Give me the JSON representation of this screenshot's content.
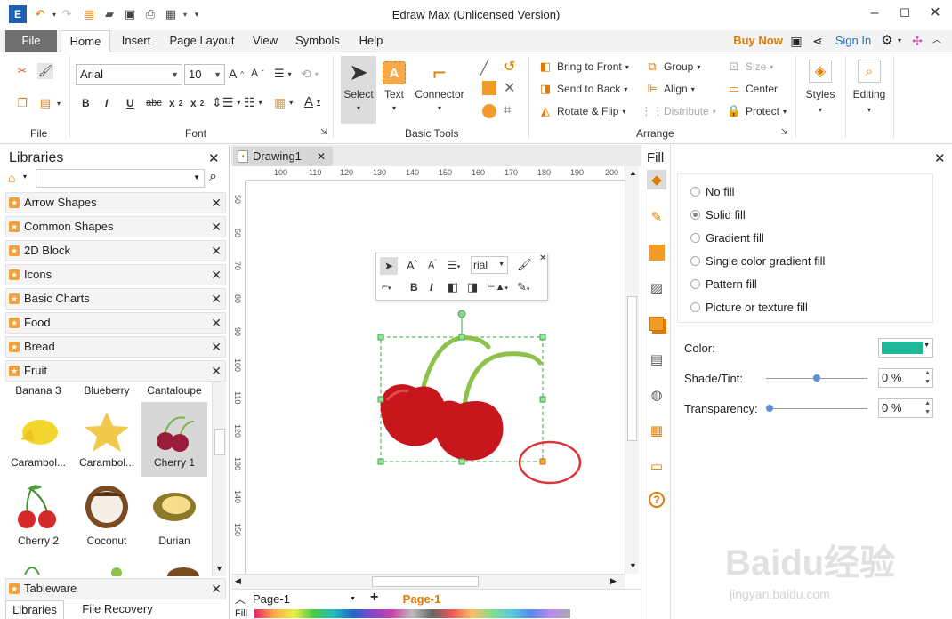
{
  "app": {
    "title": "Edraw Max (Unlicensed Version)"
  },
  "tabs": {
    "file": "File",
    "items": [
      "Home",
      "Insert",
      "Page Layout",
      "View",
      "Symbols",
      "Help"
    ],
    "buy_now": "Buy Now",
    "sign_in": "Sign In"
  },
  "ribbon": {
    "file_group": "File",
    "font_group": "Font",
    "font_name": "Arial",
    "font_size": "10",
    "basic_tools_group": "Basic Tools",
    "select": "Select",
    "text": "Text",
    "connector": "Connector",
    "arrange_group": "Arrange",
    "bring_to_front": "Bring to Front",
    "send_to_back": "Send to Back",
    "rotate_flip": "Rotate & Flip",
    "group": "Group",
    "align": "Align",
    "distribute": "Distribute",
    "size": "Size",
    "center": "Center",
    "protect": "Protect",
    "styles": "Styles",
    "editing": "Editing"
  },
  "libraries": {
    "title": "Libraries",
    "items": [
      "Arrow Shapes",
      "Common Shapes",
      "2D Block",
      "Icons",
      "Basic Charts",
      "Food",
      "Bread",
      "Fruit"
    ],
    "shape_row_top": [
      "Banana 3",
      "Blueberry",
      "Cantaloupe"
    ],
    "shape_row_1": [
      "Carambol...",
      "Carambol...",
      "Cherry 1"
    ],
    "shape_row_2": [
      "Cherry 2",
      "Coconut",
      "Durian"
    ],
    "tableware": "Tableware",
    "bottom_tab_libraries": "Libraries",
    "bottom_tab_recovery": "File Recovery"
  },
  "document": {
    "tab": "Drawing1",
    "ruler_top": [
      "100",
      "110",
      "120",
      "130",
      "140",
      "150",
      "160",
      "170",
      "180",
      "190",
      "200"
    ],
    "ruler_left": [
      "50",
      "60",
      "70",
      "80",
      "90",
      "100",
      "110",
      "120",
      "130",
      "140",
      "150"
    ],
    "page_select": "Page-1",
    "page_tab": "Page-1",
    "fill_label": "Fill"
  },
  "floating_toolbar": {
    "font": "rial"
  },
  "fill_panel": {
    "title": "Fill",
    "options": [
      "No fill",
      "Solid fill",
      "Gradient fill",
      "Single color gradient fill",
      "Pattern fill",
      "Picture or texture fill"
    ],
    "selected_index": 1,
    "color_label": "Color:",
    "color_value": "#1fb99a",
    "shade_label": "Shade/Tint:",
    "shade_value": "0 %",
    "transparency_label": "Transparency:",
    "transparency_value": "0 %"
  },
  "watermark": {
    "brand": "Baidu经验",
    "url": "jingyan.baidu.com"
  },
  "colors": {
    "accent_orange": "#f3a03b",
    "cherry_red": "#c8161d",
    "stem_green": "#8dc24a"
  }
}
